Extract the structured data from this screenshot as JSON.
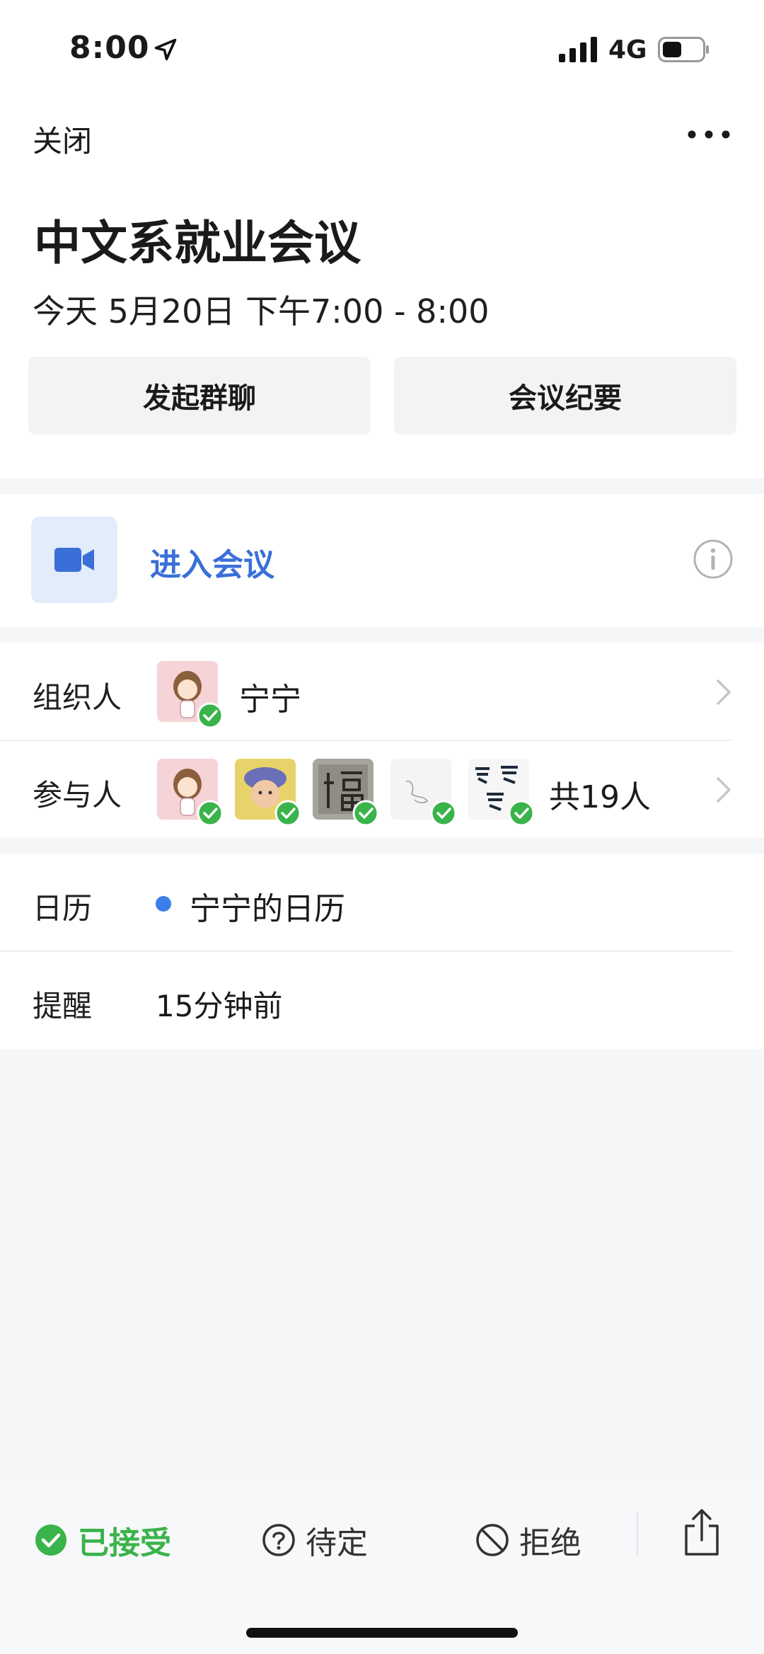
{
  "status": {
    "time": "8:00",
    "network": "4G"
  },
  "header": {
    "close_label": "关闭"
  },
  "meeting": {
    "title": "中文系就业会议",
    "datetime": "今天 5月20日 下午7:00 - 8:00"
  },
  "actions": {
    "group_chat": "发起群聊",
    "minutes": "会议纪要"
  },
  "join": {
    "label": "进入会议"
  },
  "organizer": {
    "label": "组织人",
    "name": "宁宁"
  },
  "attendees": {
    "label": "参与人",
    "count": "共19人"
  },
  "calendar": {
    "label": "日历",
    "value": "宁宁的日历"
  },
  "reminder": {
    "label": "提醒",
    "value": "15分钟前"
  },
  "rsvp": {
    "accepted": "已接受",
    "pending": "待定",
    "decline": "拒绝"
  },
  "colors": {
    "accent_blue": "#3a6fd8",
    "accept_green": "#3ab34a"
  }
}
